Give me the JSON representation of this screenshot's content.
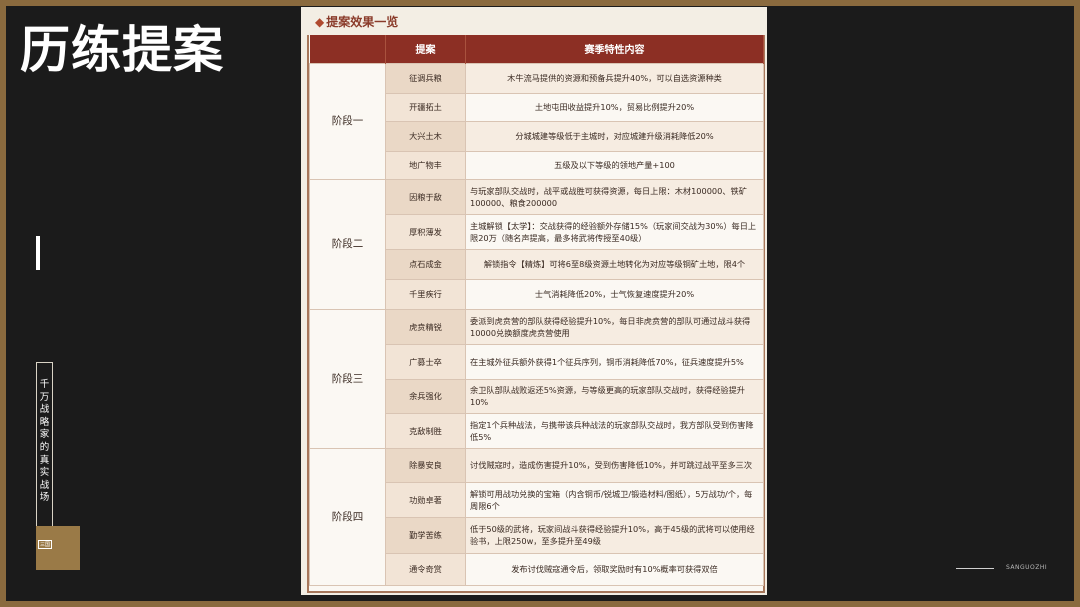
{
  "slide": {
    "title": "历练提案",
    "vertical_text": "千万战略家的真实战场",
    "square_label": "三国",
    "footer_brand": "SANGUOZHI"
  },
  "doc": {
    "title": "提案效果一览",
    "headers": [
      "提案",
      "赛季特性内容"
    ],
    "stages": [
      {
        "label": "阶段一",
        "rows": [
          {
            "name": "征调兵粮",
            "desc": "木牛流马提供的资源和预备兵提升40%，可以自选资源种类"
          },
          {
            "name": "开疆拓土",
            "desc": "土地屯田收益提升10%，贸易比例提升20%"
          },
          {
            "name": "大兴土木",
            "desc": "分城城建等级低于主城时，对应城建升级消耗降低20%"
          },
          {
            "name": "地广物丰",
            "desc": "五级及以下等级的领地产量+100"
          }
        ]
      },
      {
        "label": "阶段二",
        "rows": [
          {
            "name": "因粮于敌",
            "desc": "与玩家部队交战时，战平或战胜可获得资源，每日上限：木材100000、铁矿100000、粮食200000"
          },
          {
            "name": "厚积薄发",
            "desc": "主城解锁【太学】：交战获得的经验额外存储15%（玩家间交战为30%）每日上限20万（随名声提高，最多将武将传授至40级）"
          },
          {
            "name": "点石成金",
            "desc": "解锁指令【精炼】可将6至8级资源土地转化为对应等级铜矿土地，限4个"
          },
          {
            "name": "千里疾行",
            "desc": "士气消耗降低20%，士气恢复速度提升20%"
          }
        ]
      },
      {
        "label": "阶段三",
        "rows": [
          {
            "name": "虎贲精锐",
            "desc": "委派到虎贲营的部队获得经验提升10%，每日非虎贲营的部队可通过战斗获得10000兑换额度虎贲营使用"
          },
          {
            "name": "广募士卒",
            "desc": "在主城外征兵额外获得1个征兵序列，铜币消耗降低70%，征兵速度提升5%"
          },
          {
            "name": "余兵强化",
            "desc": "余卫队部队战败返还5%资源，与等级更高的玩家部队交战时，获得经验提升10%"
          },
          {
            "name": "克敌制胜",
            "desc": "指定1个兵种战法，与携带该兵种战法的玩家部队交战时，我方部队受到伤害降低5%"
          }
        ]
      },
      {
        "label": "阶段四",
        "rows": [
          {
            "name": "除暴安良",
            "desc": "讨伐贼寇时，造成伤害提升10%，受到伤害降低10%，并可跳过战平至多三次"
          },
          {
            "name": "功勋卓著",
            "desc": "解锁可用战功兑换的宝箱（内含铜币/锐城卫/锻造材料/图纸），5万战功/个，每周限6个"
          },
          {
            "name": "勤学苦练",
            "desc": "低于50级的武将，玩家间战斗获得经验提升10%，高于45级的武将可以使用经验书，上限250w，至多提升至49级"
          },
          {
            "name": "通令奇赏",
            "desc": "发布讨伐贼寇通令后，领取奖励时有10%概率可获得双倍"
          }
        ]
      }
    ]
  }
}
